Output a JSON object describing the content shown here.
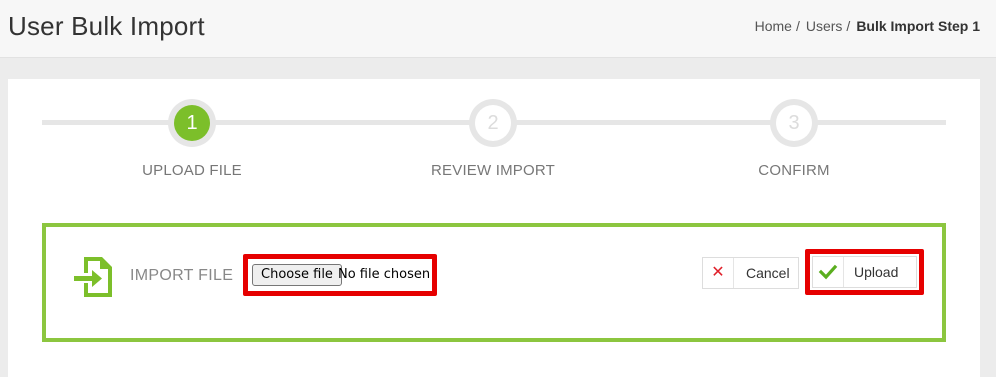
{
  "header": {
    "title": "User Bulk Import",
    "breadcrumb": {
      "home": "Home",
      "users": "Users",
      "current": "Bulk Import Step 1",
      "separator": "/"
    }
  },
  "steps": [
    {
      "number": "1",
      "label": "UPLOAD FILE",
      "active": true
    },
    {
      "number": "2",
      "label": "REVIEW IMPORT",
      "active": false
    },
    {
      "number": "3",
      "label": "CONFIRM",
      "active": false
    }
  ],
  "import": {
    "label": "IMPORT FILE",
    "icon": "file-import-icon",
    "choose_file_label": "Choose file",
    "file_status": "No file chosen"
  },
  "actions": {
    "cancel_label": "Cancel",
    "cancel_icon": "close-icon",
    "upload_label": "Upload",
    "upload_icon": "check-icon"
  },
  "colors": {
    "accent_green": "#7cbf2a",
    "box_border_green": "#8cc63f",
    "highlight_red": "#e60000",
    "cancel_icon_red": "#e0202a"
  }
}
